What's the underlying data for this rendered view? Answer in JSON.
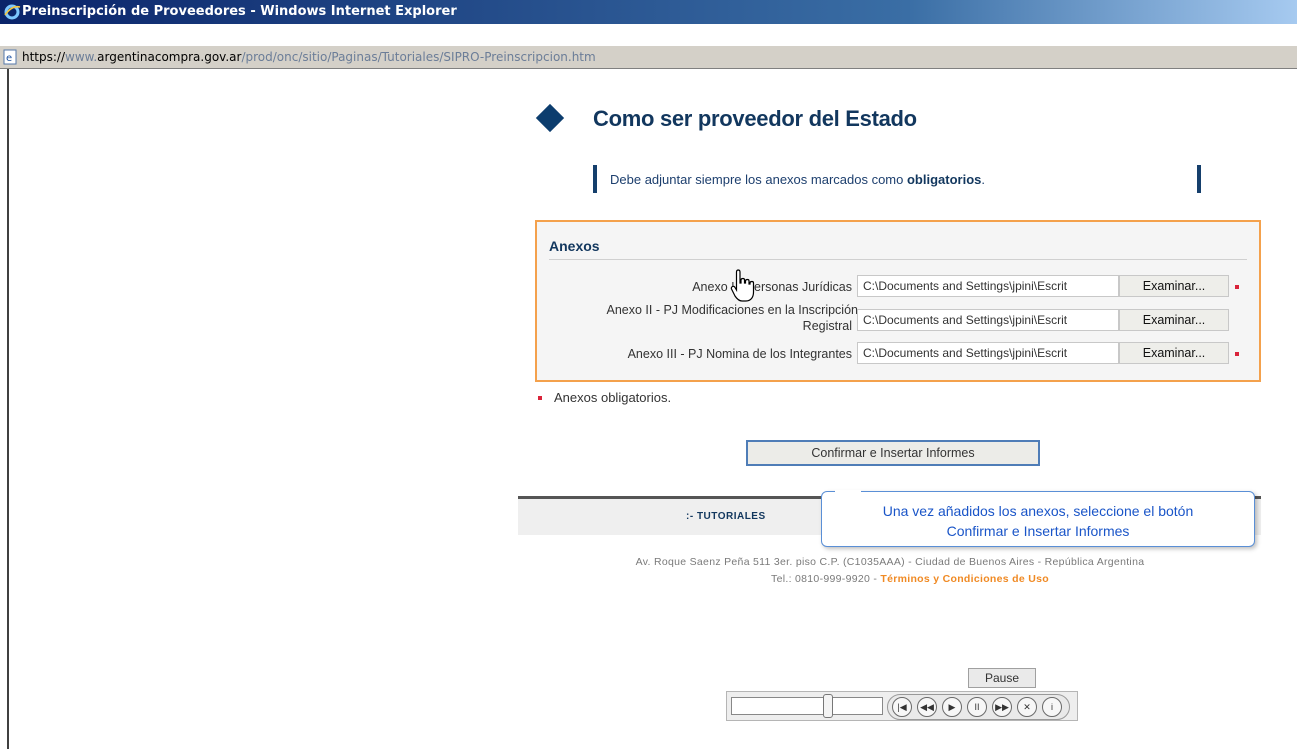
{
  "window": {
    "title": "Preinscripción de Proveedores - Windows Internet Explorer",
    "url_prefix": "https://",
    "url_domain_dim": "www.",
    "url_domain": "argentinacompra.gov.ar",
    "url_path": "/prod/onc/sitio/Paginas/Tutoriales/SIPRO-Preinscripcion.htm"
  },
  "page": {
    "title": "Como ser proveedor del Estado",
    "notice_text": "Debe adjuntar siempre los anexos marcados como ",
    "notice_bold": "obligatorios",
    "notice_end": "."
  },
  "annexes": {
    "title": "Anexos",
    "browse_label": "Examinar...",
    "items": [
      {
        "label": "Anexo I - Personas Jurídicas",
        "value": "C:\\Documents and Settings\\jpini\\Escrit",
        "required": true
      },
      {
        "label_line1": "Anexo II - PJ Modificaciones en la Inscripción",
        "label_line2": "Registral",
        "value": "C:\\Documents and Settings\\jpini\\Escrit",
        "required": false
      },
      {
        "label": "Anexo III - PJ Nomina de los Integrantes",
        "value": "C:\\Documents and Settings\\jpini\\Escrit",
        "required": true
      }
    ]
  },
  "legend": "Anexos obligatorios.",
  "confirm_button": "Confirmar e Insertar Informes",
  "callout": {
    "line1": "Una vez añadidos los anexos, seleccione el botón",
    "line2": "Confirmar e Insertar Informes"
  },
  "footer": {
    "tutorials": ":- TUTORIALES",
    "address": "Av. Roque Saenz Peña 511 3er. piso C.P. (C1035AAA) - Ciudad de Buenos Aires - República Argentina",
    "phone": "Tel.: 0810-999-9920 - ",
    "terms": "Términos y Condiciones de Uso"
  },
  "player": {
    "pause_label": "Pause",
    "controls": [
      "|◀",
      "◀◀",
      "▶",
      "II",
      "▶▶",
      "✕",
      "i"
    ],
    "progress": 0.65
  }
}
